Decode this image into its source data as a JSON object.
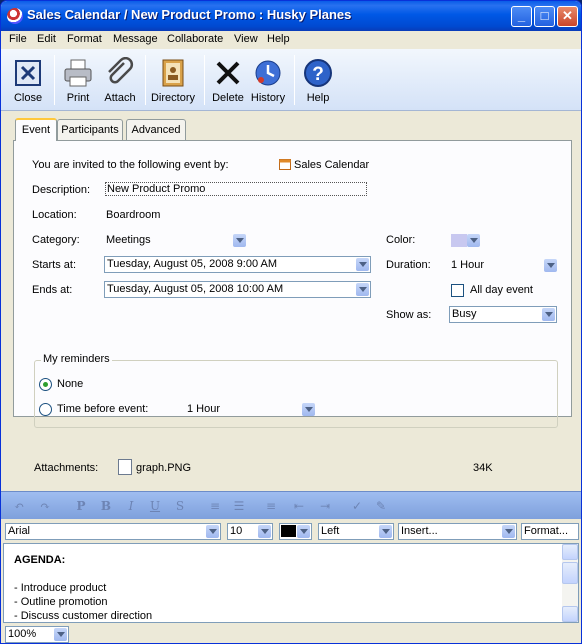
{
  "window": {
    "title": "Sales Calendar / New Product Promo : Husky Planes",
    "min": "_",
    "max": "□",
    "close": "✕"
  },
  "menu": [
    "File",
    "Edit",
    "Format",
    "Message",
    "Collaborate",
    "View",
    "Help"
  ],
  "toolbar": {
    "close": "Close",
    "print": "Print",
    "attach": "Attach",
    "directory": "Directory",
    "delete": "Delete",
    "history": "History",
    "help": "Help"
  },
  "tabs": [
    "Event",
    "Participants",
    "Advanced"
  ],
  "event": {
    "invited_label": "You are invited to the following event by:",
    "invited_by": "Sales Calendar",
    "description_label": "Description:",
    "description": "New Product Promo",
    "location_label": "Location:",
    "location": "Boardroom",
    "category_label": "Category:",
    "category": "Meetings",
    "color_label": "Color:",
    "color": "#c8c8f0",
    "starts_label": "Starts at:",
    "starts": "Tuesday, August 05, 2008 9:00 AM",
    "duration_label": "Duration:",
    "duration": "1 Hour",
    "ends_label": "Ends at:",
    "ends": "Tuesday, August 05, 2008 10:00 AM",
    "allday_label": "All day event",
    "showas_label": "Show as:",
    "showas": "Busy"
  },
  "reminders": {
    "legend": "My reminders",
    "none_label": "None",
    "before_label": "Time before event:",
    "before_value": "1 Hour"
  },
  "attachments": {
    "label": "Attachments:",
    "file": "graph.PNG",
    "size": "34K"
  },
  "format": {
    "font": "Arial",
    "size": "10",
    "align": "Left",
    "insert": "Insert...",
    "format": "Format..."
  },
  "editor": {
    "lines": [
      "AGENDA:",
      "",
      "- Introduce product",
      "- Outline promotion",
      "- Discuss customer direction"
    ]
  },
  "status": {
    "zoom": "100%"
  }
}
